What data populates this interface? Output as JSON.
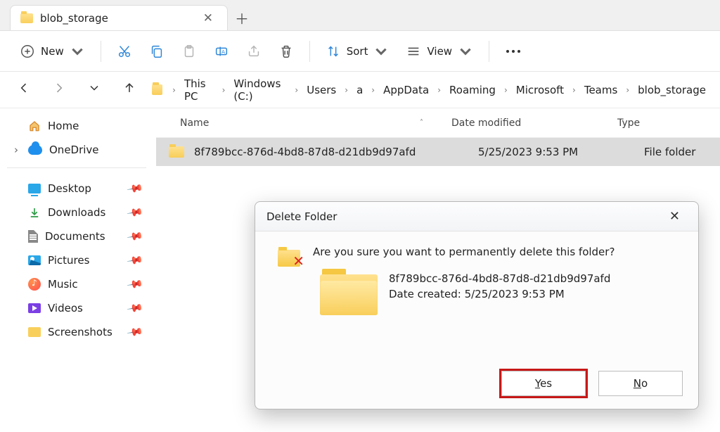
{
  "tab": {
    "title": "blob_storage"
  },
  "toolbar": {
    "new": "New",
    "sort": "Sort",
    "view": "View"
  },
  "breadcrumb": [
    "This PC",
    "Windows (C:)",
    "Users",
    "a",
    "AppData",
    "Roaming",
    "Microsoft",
    "Teams",
    "blob_storage"
  ],
  "columns": {
    "name": "Name",
    "date": "Date modified",
    "type": "Type"
  },
  "rows": [
    {
      "name": "8f789bcc-876d-4bd8-87d8-d21db9d97afd",
      "date": "5/25/2023 9:53 PM",
      "type": "File folder"
    }
  ],
  "side_top": [
    {
      "label": "Home"
    },
    {
      "label": "OneDrive"
    }
  ],
  "side_pinned": [
    {
      "label": "Desktop"
    },
    {
      "label": "Downloads"
    },
    {
      "label": "Documents"
    },
    {
      "label": "Pictures"
    },
    {
      "label": "Music"
    },
    {
      "label": "Videos"
    },
    {
      "label": "Screenshots"
    }
  ],
  "dialog": {
    "title": "Delete Folder",
    "question": "Are you sure you want to permanently delete this folder?",
    "item_name": "8f789bcc-876d-4bd8-87d8-d21db9d97afd",
    "created_label": "Date created: 5/25/2023 9:53 PM",
    "yes": "Yes",
    "no": "No"
  }
}
